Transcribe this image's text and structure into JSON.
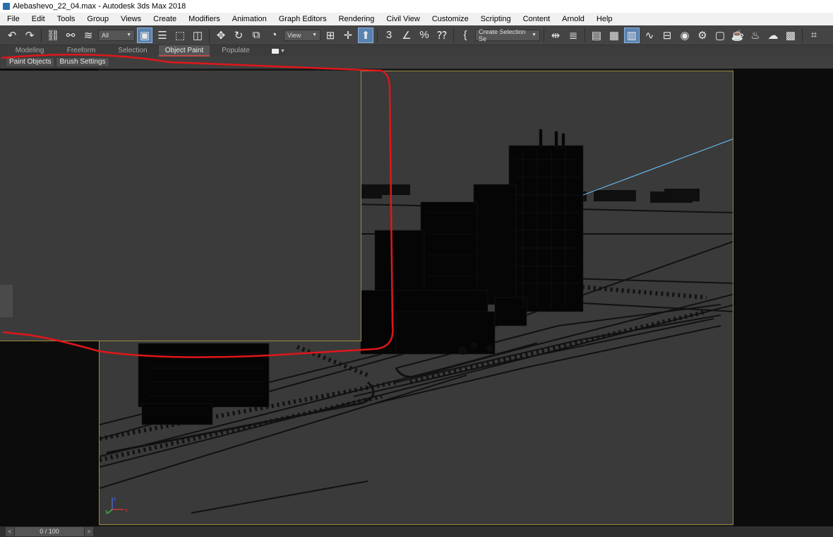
{
  "window": {
    "title": "Alebashevo_22_04.max - Autodesk 3ds Max 2018",
    "app_icon": "3dsmax-icon"
  },
  "menu": [
    "File",
    "Edit",
    "Tools",
    "Group",
    "Views",
    "Create",
    "Modifiers",
    "Animation",
    "Graph Editors",
    "Rendering",
    "Civil View",
    "Customize",
    "Scripting",
    "Content",
    "Arnold",
    "Help"
  ],
  "toolbar": {
    "selection_filter": "All",
    "ref_coord_system": "View",
    "named_selection_placeholder": "Create Selection Se",
    "icons": [
      "undo-icon",
      "redo-icon",
      "link-icon",
      "unlink-icon",
      "bind-space-warp-icon",
      "select-object-icon",
      "select-by-name-icon",
      "rect-selection-icon",
      "window-crossing-icon",
      "move-icon",
      "rotate-icon",
      "scale-icon",
      "place-icon",
      "pivot-icon",
      "select-manipulate-icon",
      "snaps-icon",
      "angle-snap-icon",
      "percent-snap-icon",
      "spinner-snap-icon",
      "edit-named-sets-icon",
      "mirror-icon",
      "align-icon",
      "scene-explorer-icon",
      "layer-explorer-icon",
      "toggle-ribbon-icon",
      "curve-editor-icon",
      "schematic-view-icon",
      "material-editor-icon",
      "render-setup-icon",
      "rendered-frame-icon",
      "render-production-icon",
      "render-iterative-icon",
      "render-in-cloud-icon",
      "a360-gallery-icon",
      "crop-icon"
    ]
  },
  "ribbon": {
    "tabs": [
      "Modeling",
      "Freeform",
      "Selection",
      "Object Paint",
      "Populate"
    ],
    "active_tab": "Object Paint",
    "sub_buttons": [
      "Paint Objects",
      "Brush Settings"
    ]
  },
  "viewport": {
    "border_color": "#9b8a3a",
    "axis_labels": [
      "z",
      "y",
      "x"
    ]
  },
  "annotation": {
    "color": "#e0161b"
  },
  "timeline": {
    "frame": "0 / 100",
    "prev": "<",
    "next": ">"
  }
}
